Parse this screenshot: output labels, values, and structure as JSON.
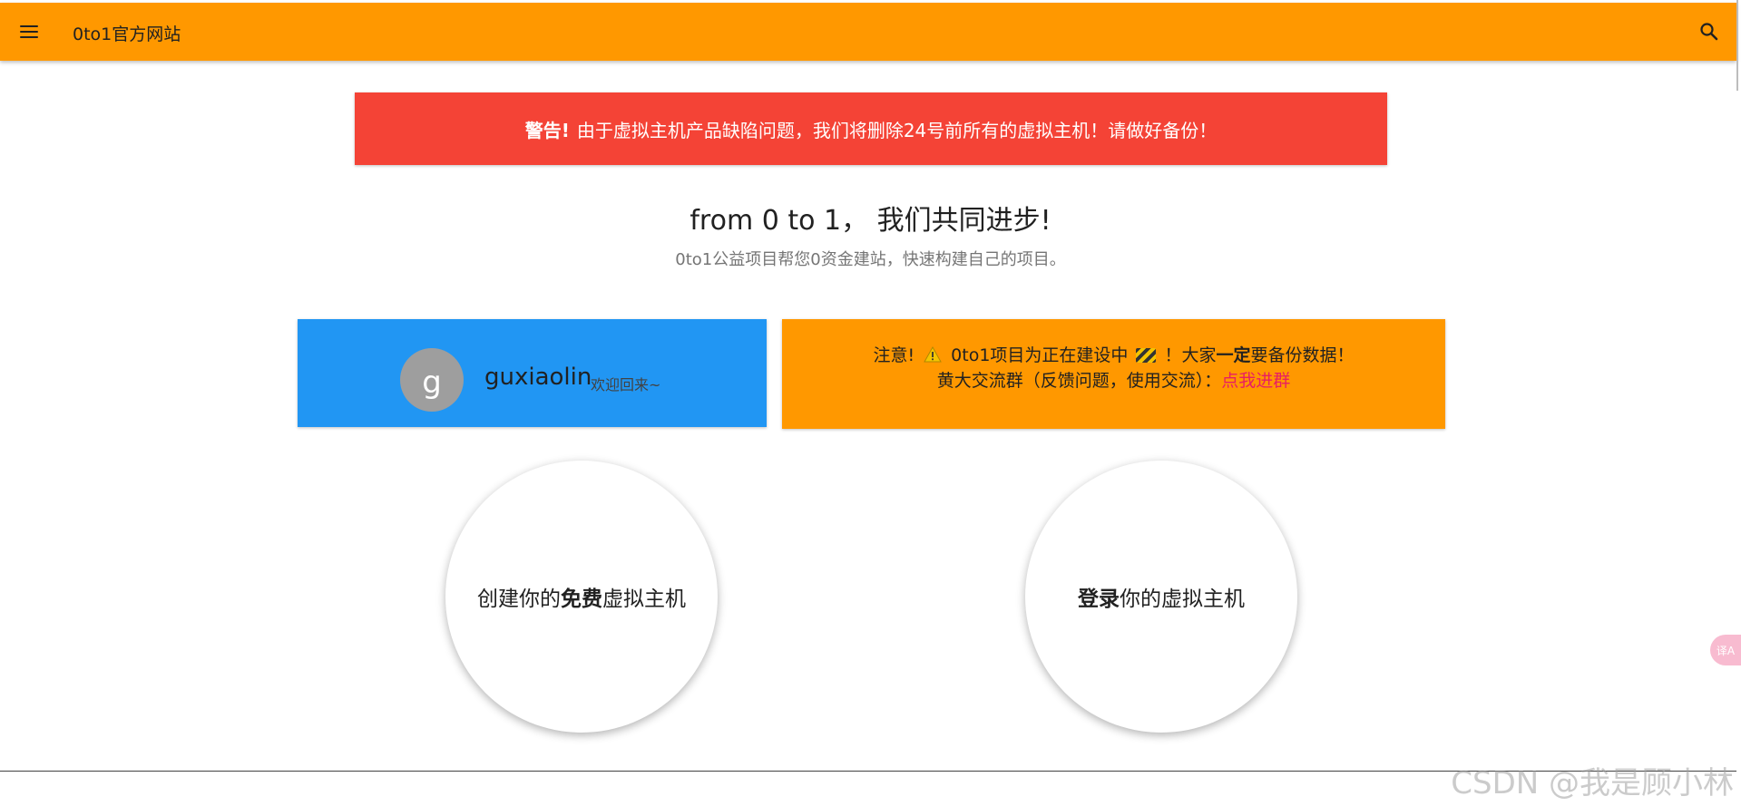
{
  "appbar": {
    "title": "0to1官方网站",
    "menu_icon": "menu-icon",
    "search_icon": "search-icon",
    "color": "#ff9800"
  },
  "warning_banner": {
    "strong": "警告!",
    "text": "由于虚拟主机产品缺陷问题，我们将删除24号前所有的虚拟主机！请做好备份！",
    "color": "#f44336"
  },
  "hero": {
    "title": "from 0 to 1， 我们共同进步!",
    "subtitle": "0to1公益项目帮您0资金建站，快速构建自己的项目。"
  },
  "user_card": {
    "avatar_letter": "g",
    "username": "guxiaolin",
    "welcome": "欢迎回来~",
    "color": "#2196f3"
  },
  "notice_card": {
    "prefix": "注意!",
    "warn_icon": "warning-icon",
    "text_a": "0to1项目为正在建设中",
    "construction_icon": "construction-icon",
    "text_b": "！大家",
    "text_bold": "一定",
    "text_c": "要备份数据！",
    "line2": "黄大交流群（反馈问题，使用交流）：",
    "link": "点我进群",
    "color": "#ff9800",
    "link_color": "#e91e63"
  },
  "actions": {
    "create": {
      "pre": "创建你的",
      "bold": "免费",
      "post": "虚拟主机"
    },
    "login": {
      "bold": "登录",
      "post": "你的虚拟主机"
    }
  },
  "translate_fab": {
    "icon": "translate-icon",
    "label": "译A"
  },
  "watermark": "CSDN @我是顾小林"
}
